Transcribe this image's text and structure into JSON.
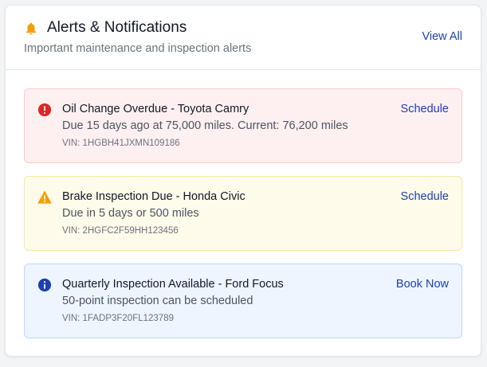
{
  "header": {
    "title": "Alerts & Notifications",
    "subtitle": "Important maintenance and inspection alerts",
    "view_all_label": "View All",
    "icon": "bell-icon"
  },
  "colors": {
    "accent": "#1e40af",
    "bell": "#f59e0b",
    "danger": "#dc2626",
    "warning": "#f59e0b",
    "info": "#1e40af"
  },
  "alerts": [
    {
      "severity": "danger",
      "icon": "exclamation-circle-icon",
      "title": "Oil Change Overdue - Toyota Camry",
      "description": "Due 15 days ago at 75,000 miles. Current: 76,200 miles",
      "vin": "VIN: 1HGBH41JXMN109186",
      "action": "Schedule"
    },
    {
      "severity": "warning",
      "icon": "warning-triangle-icon",
      "title": "Brake Inspection Due - Honda Civic",
      "description": "Due in 5 days or 500 miles",
      "vin": "VIN: 2HGFC2F59HH123456",
      "action": "Schedule"
    },
    {
      "severity": "info",
      "icon": "info-circle-icon",
      "title": "Quarterly Inspection Available - Ford Focus",
      "description": "50-point inspection can be scheduled",
      "vin": "VIN: 1FADP3F20FL123789",
      "action": "Book Now"
    }
  ]
}
